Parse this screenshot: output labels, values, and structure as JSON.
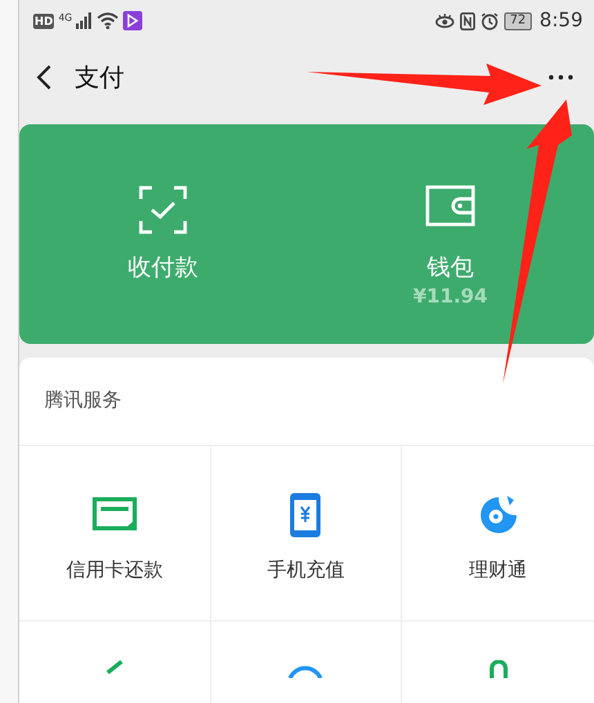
{
  "status_bar": {
    "left": [
      "HD",
      "4G"
    ],
    "battery": "72",
    "time": "8:59"
  },
  "nav": {
    "title": "支付"
  },
  "wallet_card": {
    "items": [
      {
        "kind": "scan",
        "label": "收付款"
      },
      {
        "kind": "wallet",
        "label": "钱包",
        "sub": "¥11.94"
      }
    ]
  },
  "services": {
    "title": "腾讯服务",
    "items": [
      {
        "kind": "card",
        "label": "信用卡还款"
      },
      {
        "kind": "phone",
        "label": "手机充值"
      },
      {
        "kind": "fund",
        "label": "理财通"
      }
    ]
  }
}
